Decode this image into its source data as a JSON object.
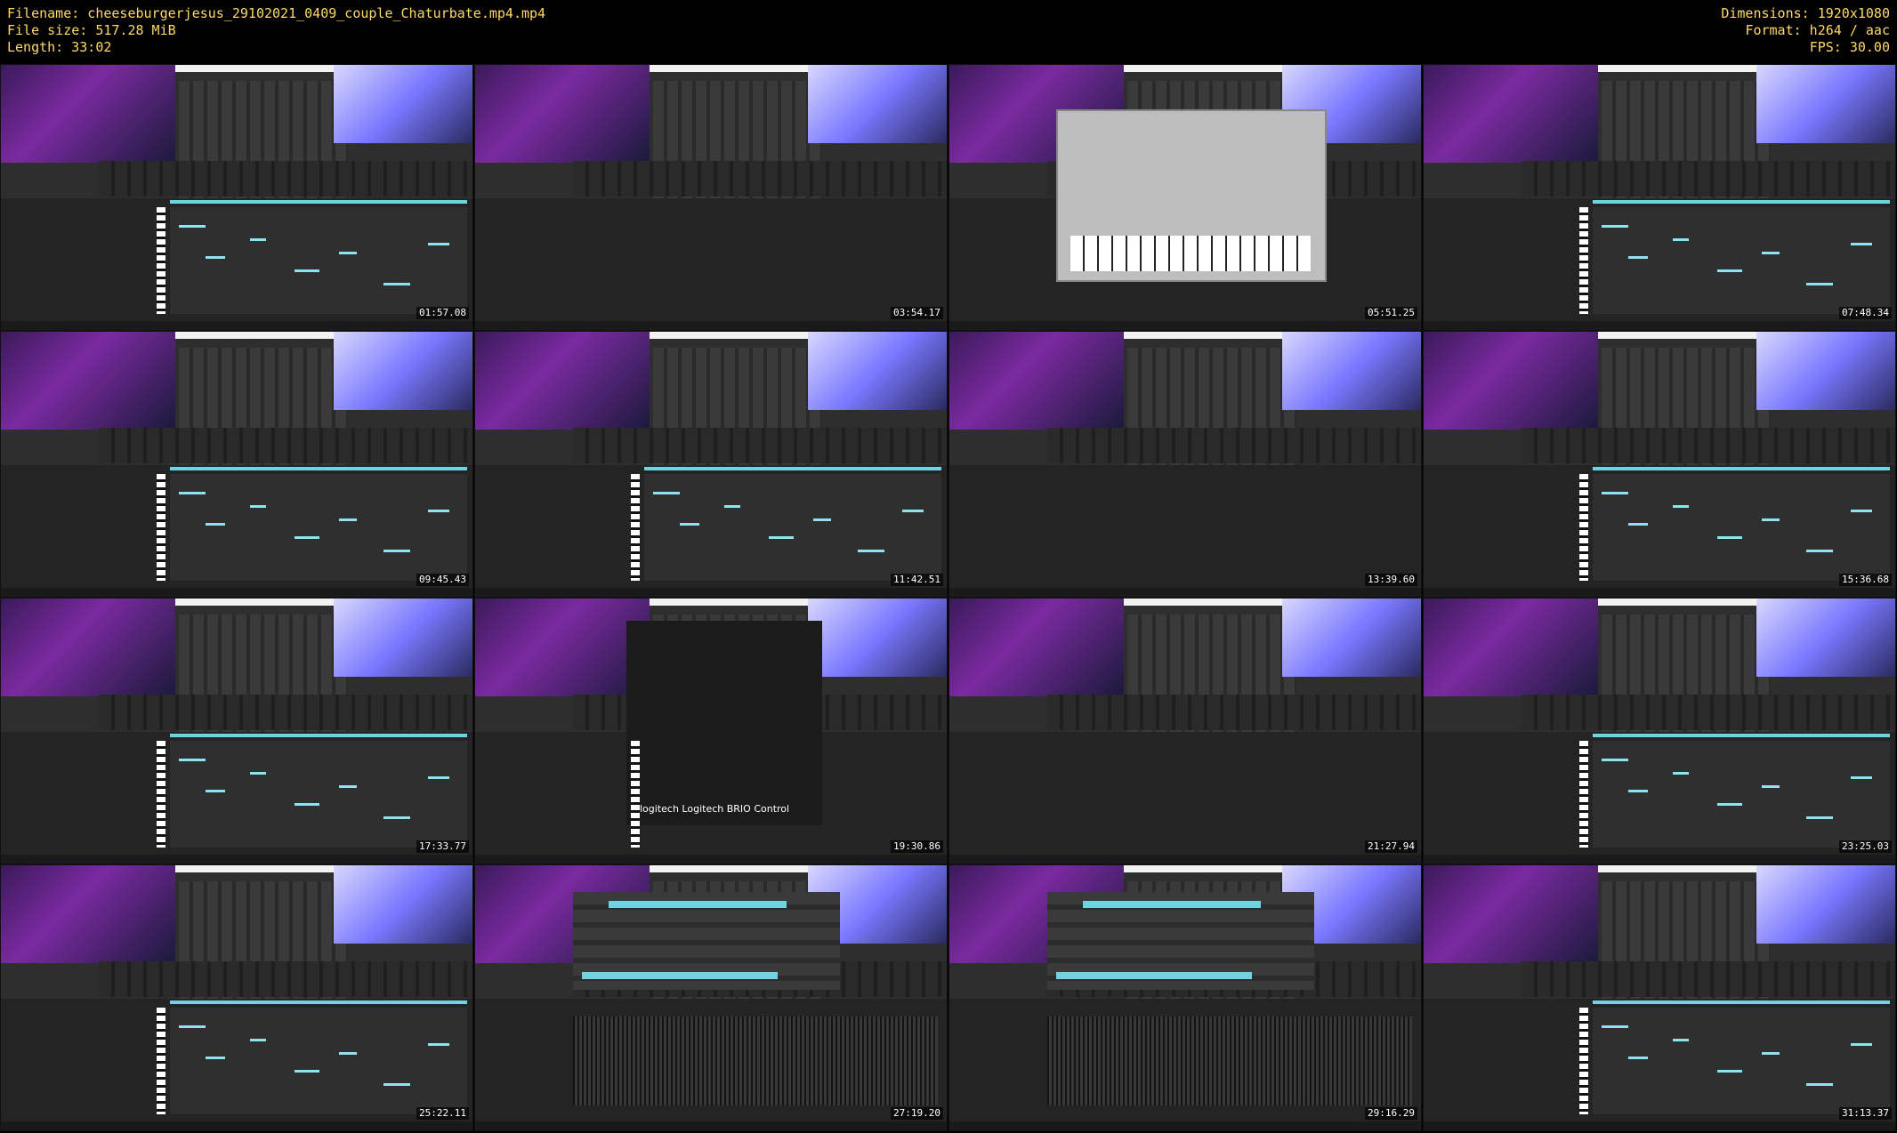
{
  "header": {
    "filename": "Filename: cheeseburgerjesus_29102021_0409_couple_Chaturbate.mp4.mp4",
    "filesize": "File size: 517.28 MiB",
    "length": "Length: 33:02",
    "dimensions": "Dimensions: 1920x1080",
    "format": "Format: h264 / aac",
    "fps": "FPS: 30.00"
  },
  "thumbnails": [
    {
      "timestamp": "01:57.08",
      "variant": "roll"
    },
    {
      "timestamp": "03:54.17",
      "variant": "empty"
    },
    {
      "timestamp": "05:51.25",
      "variant": "synth"
    },
    {
      "timestamp": "07:48.34",
      "variant": "roll"
    },
    {
      "timestamp": "09:45.43",
      "variant": "roll"
    },
    {
      "timestamp": "11:42.51",
      "variant": "roll"
    },
    {
      "timestamp": "13:39.60",
      "variant": "empty"
    },
    {
      "timestamp": "15:36.68",
      "variant": "roll"
    },
    {
      "timestamp": "17:33.77",
      "variant": "roll"
    },
    {
      "timestamp": "19:30.86",
      "variant": "logitech"
    },
    {
      "timestamp": "21:27.94",
      "variant": "empty"
    },
    {
      "timestamp": "23:25.03",
      "variant": "roll"
    },
    {
      "timestamp": "25:22.11",
      "variant": "roll"
    },
    {
      "timestamp": "27:19.20",
      "variant": "audio"
    },
    {
      "timestamp": "29:16.29",
      "variant": "audio"
    },
    {
      "timestamp": "31:13.37",
      "variant": "roll"
    }
  ],
  "overlay_text": {
    "logitech_brand": "logitech",
    "logitech_control": "Logitech BRIO Control"
  },
  "colors": {
    "header_text": "#ffd966",
    "accent": "#6fd3e0"
  }
}
